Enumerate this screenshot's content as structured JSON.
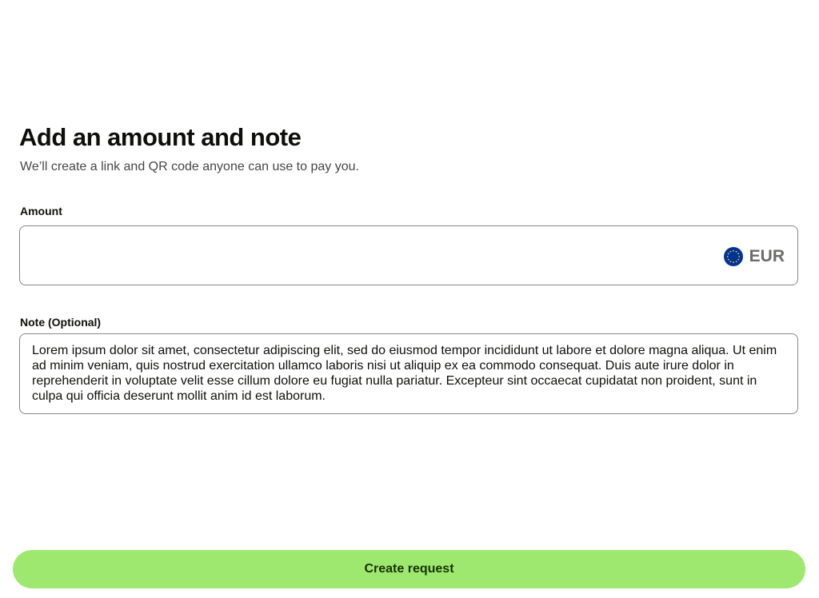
{
  "header": {
    "title": "Add an amount and note",
    "subtitle": "We’ll create a link and QR code anyone can use to pay you."
  },
  "amount": {
    "label": "Amount",
    "value": "",
    "currency": {
      "code": "EUR",
      "flag_icon": "eu-flag-icon",
      "flag_colors": {
        "background": "#003399",
        "stars": "#ffcc00"
      }
    }
  },
  "note": {
    "label": "Note (Optional)",
    "value": "Lorem ipsum dolor sit amet, consectetur adipiscing elit, sed do eiusmod tempor incididunt ut labore et dolore magna aliqua. Ut enim ad minim veniam, quis nostrud exercitation ullamco laboris nisi ut aliquip ex ea commodo consequat. Duis aute irure dolor in reprehenderit in voluptate velit esse cillum dolore eu fugiat nulla pariatur. Excepteur sint occaecat cupidatat non proident, sunt in culpa qui officia deserunt mollit anim id est laborum."
  },
  "actions": {
    "create_label": "Create request"
  },
  "colors": {
    "primary_button": "#9fe870",
    "primary_button_text": "#163300",
    "border": "#868685",
    "text": "#0e0f0c",
    "secondary_text": "#454745"
  }
}
